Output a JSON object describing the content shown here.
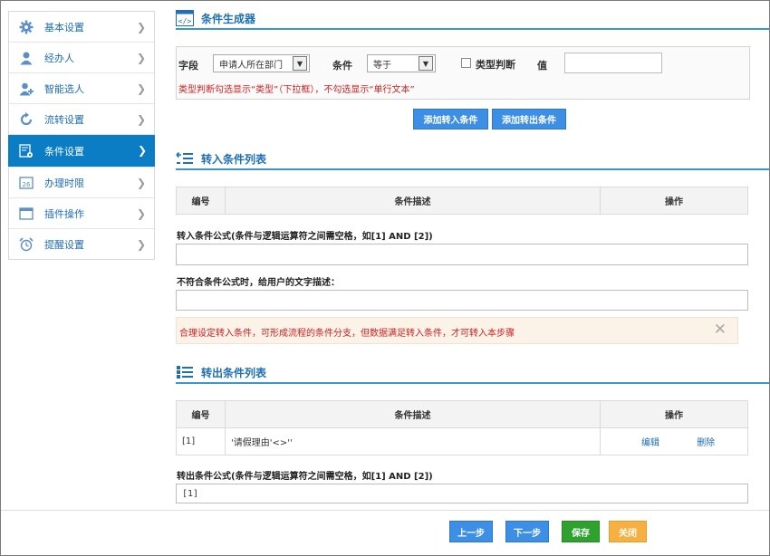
{
  "sidebar": {
    "items": [
      {
        "label": "基本设置",
        "icon": "gear-icon"
      },
      {
        "label": "经办人",
        "icon": "user-icon"
      },
      {
        "label": "智能选人",
        "icon": "user-add-icon"
      },
      {
        "label": "流转设置",
        "icon": "refresh-icon"
      },
      {
        "label": "条件设置",
        "icon": "condition-settings-icon",
        "active": true
      },
      {
        "label": "办理时限",
        "icon": "calendar-icon"
      },
      {
        "label": "插件操作",
        "icon": "window-icon"
      },
      {
        "label": "提醒设置",
        "icon": "alarm-clock-icon"
      }
    ]
  },
  "builder": {
    "title": "条件生成器",
    "field_label": "字段",
    "field_value": "申请人所在部门",
    "condition_label": "条件",
    "condition_value": "等于",
    "type_check_label": "类型判断",
    "value_label": "值",
    "value_input": "",
    "hint": "类型判断勾选显示“类型”（下拉框），不勾选显示“单行文本”",
    "add_in_button": "添加转入条件",
    "add_out_button": "添加转出条件"
  },
  "in_section": {
    "title": "转入条件列表",
    "columns": [
      "编号",
      "条件描述",
      "操作"
    ],
    "formula_label": "转入条件公式(条件与逻辑运算符之间需空格，如[1] AND [2])",
    "formula_value": "",
    "desc_label": "不符合条件公式时，给用户的文字描述：",
    "desc_value": "",
    "alert": "合理设定转入条件，可形成流程的条件分支，但数据满足转入条件，才可转入本步骤"
  },
  "out_section": {
    "title": "转出条件列表",
    "columns": [
      "编号",
      "条件描述",
      "操作"
    ],
    "rows": [
      {
        "id": "[1]",
        "desc": "'请假理由'<>''",
        "edit": "编辑",
        "delete": "删除"
      }
    ],
    "formula_label": "转出条件公式(条件与逻辑运算符之间需空格，如[1] AND [2])",
    "formula_value": "[1]"
  },
  "footer": {
    "prev": "上一步",
    "next": "下一步",
    "save": "保存",
    "close": "关闭"
  },
  "colors": {
    "accent": "#0b7dc4",
    "header_line": "#3a95d6",
    "button_blue": "#3d8ee5",
    "save_green": "#2fa12f",
    "close_orange": "#f5b041",
    "hint_red": "#d01f1f"
  }
}
